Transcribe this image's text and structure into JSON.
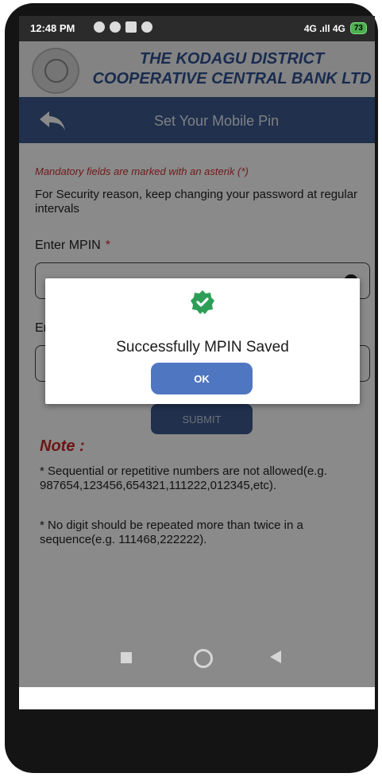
{
  "status_bar": {
    "time": "12:48 PM",
    "network": "4G .ıll 4G",
    "battery": "73"
  },
  "bank": {
    "name_line1": "THE KODAGU DISTRICT",
    "name_line2": "COOPERATIVE CENTRAL BANK LTD"
  },
  "appbar": {
    "title": "Set Your Mobile Pin"
  },
  "form": {
    "mandatory_note": "Mandatory fields are marked with an asterik (*)",
    "security_note": "For Security reason, keep changing your password at regular intervals",
    "mpin_label": "Enter MPIN",
    "required_mark": "*",
    "field2_label": "Er",
    "submit_label": "SUBMIT"
  },
  "note": {
    "title": "Note :",
    "item1": "* Sequential or repetitive numbers are not allowed(e.g. 987654,123456,654321,111222,012345,etc).",
    "item2": "* No digit should be repeated more than twice in a sequence(e.g. 111468,222222)."
  },
  "dialog": {
    "message": "Successfully MPIN Saved",
    "ok_label": "OK"
  },
  "colors": {
    "brand_blue": "#3c5a8e",
    "ok_blue": "#4f76c0",
    "success_green": "#2e9e57",
    "error_red": "#d32f2f"
  }
}
